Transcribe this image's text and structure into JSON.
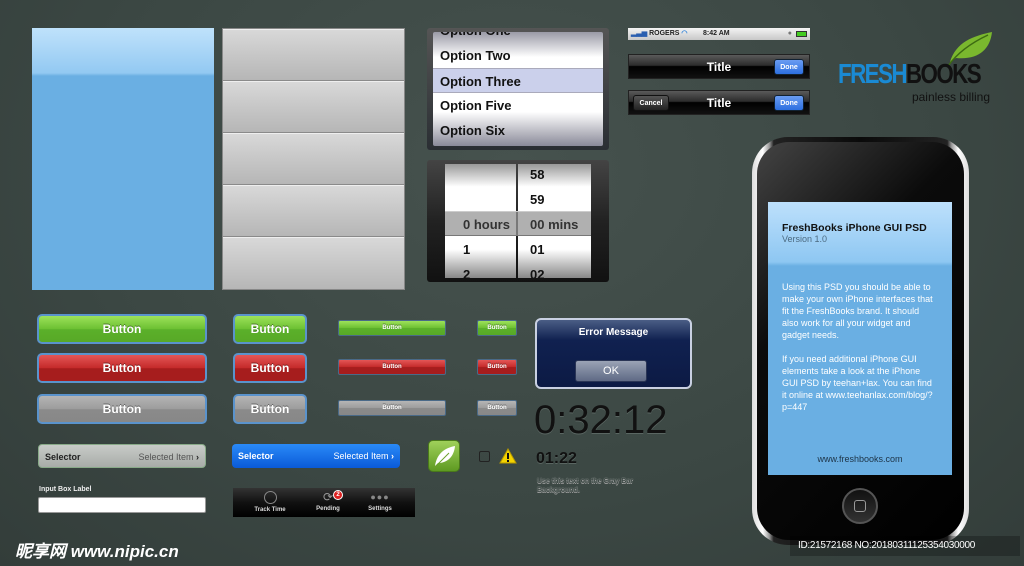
{
  "picker": {
    "options": [
      "Option One",
      "Option Two",
      "Option Three",
      "Option Five",
      "Option Six"
    ],
    "selected": "Option Three"
  },
  "time_picker": {
    "hours": [
      "",
      "",
      "0 hours",
      "1",
      "2"
    ],
    "minutes": [
      "58",
      "59",
      "00 mins",
      "01",
      "02"
    ]
  },
  "status_bar": {
    "carrier": "ROGERS",
    "time": "8:42 AM"
  },
  "navbar1": {
    "title": "Title",
    "done": "Done"
  },
  "navbar2": {
    "title": "Title",
    "done": "Done",
    "cancel": "Cancel"
  },
  "logo": {
    "brand": "FreshBooks",
    "tagline": "painless billing",
    "colors": {
      "fresh": "#1a8ad4",
      "books": "#111111",
      "leaf": "#7ab82e"
    }
  },
  "buttons": {
    "label": "Button",
    "colors": {
      "green": "#6cc032",
      "red": "#c42a2a",
      "gray": "#9c9c9c"
    }
  },
  "alert": {
    "title": "Error Message",
    "ok": "OK"
  },
  "timer": {
    "large": "0:32:12",
    "small": "01:22",
    "note": "Use this text on the Gray Bar Background."
  },
  "selector_gray": {
    "label": "Selector",
    "value": "Selected Item"
  },
  "selector_blue": {
    "label": "Selector",
    "value": "Selected Item"
  },
  "input": {
    "label": "Input Box Label",
    "value": ""
  },
  "tabbar": {
    "items": [
      {
        "label": "Track Time",
        "icon": "clock-icon"
      },
      {
        "label": "Pending",
        "icon": "refresh-icon",
        "badge": "2"
      },
      {
        "label": "Settings",
        "icon": "more-icon"
      }
    ]
  },
  "phone": {
    "title": "FreshBooks iPhone GUI PSD",
    "version": "Version 1.0",
    "para1": "Using this PSD you should be able to make your own iPhone interfaces that fit the FreshBooks brand. It should also work for all your widget and gadget needs.",
    "para2": "If you need additional iPhone GUI elements take a look at the iPhone GUI PSD by teehan+lax. You can find it online at www.teehanlax.com/blog/?p=447",
    "footer": "www.freshbooks.com"
  },
  "watermark": {
    "site": "昵享网 www.nipic.cn",
    "id": "ID:21572168 NO:20180311125354030000"
  }
}
